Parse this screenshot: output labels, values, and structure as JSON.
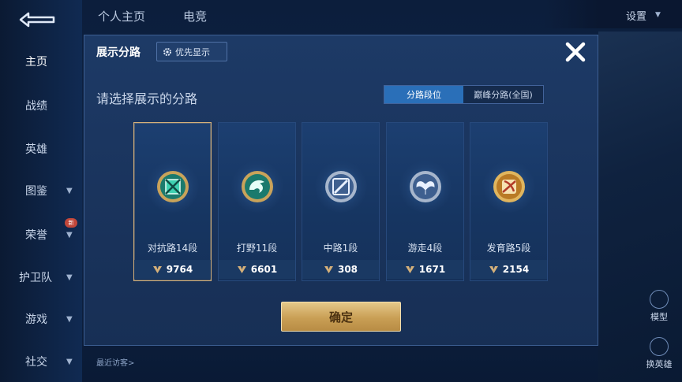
{
  "sidebar": {
    "items": [
      {
        "label": "主页"
      },
      {
        "label": "战绩"
      },
      {
        "label": "英雄"
      },
      {
        "label": "图鉴"
      },
      {
        "label": "荣誉"
      },
      {
        "label": "护卫队"
      },
      {
        "label": "游戏"
      },
      {
        "label": "社交"
      }
    ],
    "hot_badge": "新"
  },
  "topbar": {
    "tabs": [
      {
        "label": "个人主页"
      },
      {
        "label": "电竞"
      }
    ],
    "settings": "设置"
  },
  "right_panel": {
    "model_label": "模型",
    "change_hero_label": "换英雄"
  },
  "visitors_label": "最近访客>",
  "dialog": {
    "title": "展示分路",
    "priority_button": "优先显示",
    "prompt": "请选择展示的分路",
    "segments": [
      {
        "label": "分路段位",
        "active": true
      },
      {
        "label": "巅峰分路(全国)",
        "active": false
      }
    ],
    "cards": [
      {
        "rank": "对抗路14段",
        "score": "9764",
        "selected": true,
        "emblem": "sword-cross-icon",
        "color": "#2fb39a"
      },
      {
        "rank": "打野11段",
        "score": "6601",
        "selected": false,
        "emblem": "dragon-icon",
        "color": "#2fb39a"
      },
      {
        "rank": "中路1段",
        "score": "308",
        "selected": false,
        "emblem": "staff-icon",
        "color": "#9fb0c8"
      },
      {
        "rank": "游走4段",
        "score": "1671",
        "selected": false,
        "emblem": "wings-icon",
        "color": "#9fb0c8"
      },
      {
        "rank": "发育路5段",
        "score": "2154",
        "selected": false,
        "emblem": "bow-icon",
        "color": "#d7a24a"
      }
    ],
    "confirm_button": "确定"
  },
  "colors": {
    "accent_blue": "#2a6fb8",
    "gold": "#d4b07a",
    "dialog_bg": "#1a345d"
  }
}
